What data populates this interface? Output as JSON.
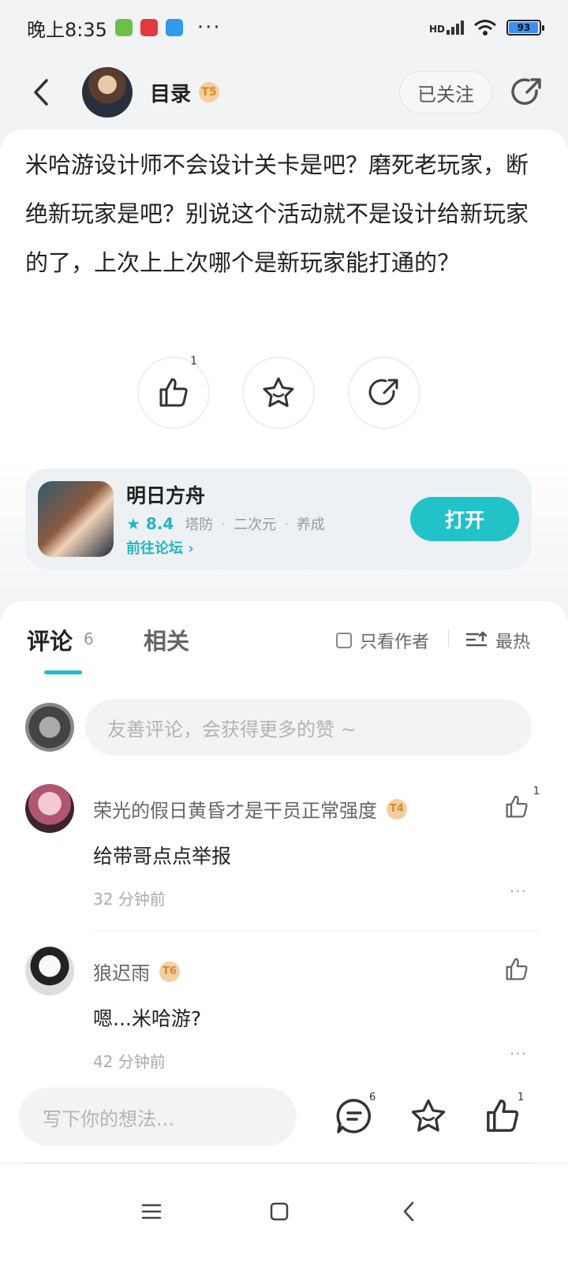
{
  "status_bar": {
    "time": "晚上8:35",
    "more": "···",
    "signal_label": "HD",
    "battery": "93",
    "battery_level": 0.93,
    "colors": {
      "app1": "#6cc04a",
      "app2": "#e0393e",
      "app3": "#2f9bea"
    }
  },
  "header": {
    "author_name": "目录",
    "author_level": "T5",
    "follow_label": "已关注"
  },
  "post": {
    "text": "米哈游设计师不会设计关卡是吧？磨死老玩家，断绝新玩家是吧？别说这个活动就不是设计给新玩家的了，上次上上次哪个是新玩家能打通的？",
    "like_count": "1"
  },
  "game": {
    "name": "明日方舟",
    "rating": "8.4",
    "tags": [
      "塔防",
      "二次元",
      "养成"
    ],
    "separator": "·",
    "forum_link": "前往论坛",
    "open_label": "打开",
    "accent_color": "#22c2c9"
  },
  "comments_section": {
    "tab_comments": "评论",
    "comments_count": "6",
    "tab_related": "相关",
    "only_author": "只看作者",
    "sort_label": "最热",
    "input_placeholder": "友善评论，会获得更多的赞 ~",
    "items": [
      {
        "name": "荣光的假日黄昏才是干员正常强度",
        "level": "T4",
        "text": "给带哥点点举报",
        "time": "32 分钟前",
        "likes": "1",
        "more": "···"
      },
      {
        "name": "狼迟雨",
        "level": "T6",
        "text": "嗯...米哈游?",
        "time": "42 分钟前",
        "likes": "",
        "more": "···"
      }
    ]
  },
  "bottom_bar": {
    "placeholder": "写下你的想法...",
    "comment_count": "6",
    "like_count": "1"
  }
}
